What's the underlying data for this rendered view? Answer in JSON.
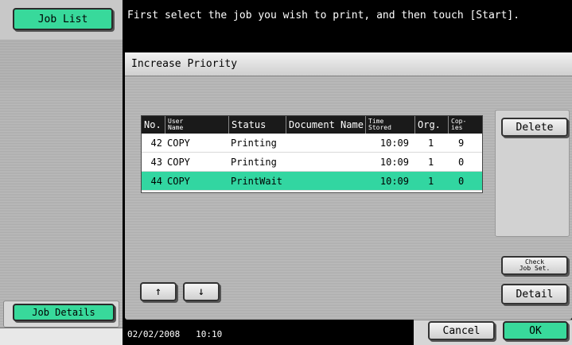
{
  "header": {
    "message": "First select the job you wish to print, and then touch [Start]."
  },
  "left_panel": {
    "job_list_label": "Job List",
    "job_details_label": "Job Details"
  },
  "dialog": {
    "title": "Increase Priority"
  },
  "table": {
    "columns": {
      "no": "No.",
      "user_name_1": "User",
      "user_name_2": "Name",
      "status": "Status",
      "document_name": "Document Name",
      "time_stored_1": "Time",
      "time_stored_2": "Stored",
      "org": "Org.",
      "copies_1": "Cop-",
      "copies_2": "ies"
    },
    "rows": [
      {
        "no": "42",
        "user": "COPY",
        "status": "Printing",
        "document": "",
        "time": "10:09",
        "org": "1",
        "copies": "9",
        "selected": false
      },
      {
        "no": "43",
        "user": "COPY",
        "status": "Printing",
        "document": "",
        "time": "10:09",
        "org": "1",
        "copies": "0",
        "selected": false
      },
      {
        "no": "44",
        "user": "COPY",
        "status": "PrintWait",
        "document": "",
        "time": "10:09",
        "org": "1",
        "copies": "0",
        "selected": true
      }
    ]
  },
  "buttons": {
    "delete": "Delete",
    "check_job_set_1": "Check",
    "check_job_set_2": "Job Set.",
    "detail": "Detail",
    "up": "↑",
    "down": "↓",
    "cancel": "Cancel",
    "ok": "OK"
  },
  "footer": {
    "date": "02/02/2008",
    "time": "10:10"
  },
  "colors": {
    "accent": "#38d99b",
    "selected_row": "#32d6a1"
  }
}
